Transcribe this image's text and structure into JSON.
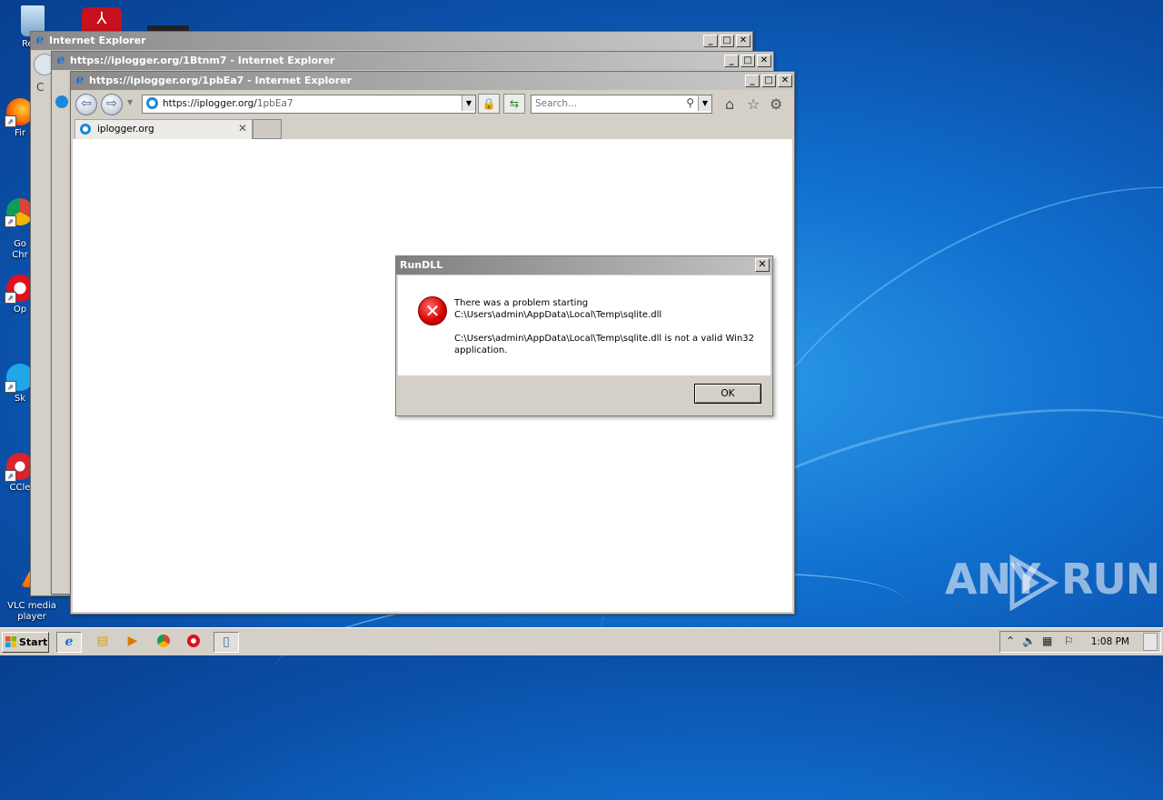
{
  "desktop": {
    "icons": [
      {
        "label": "Recy",
        "icon": "recycle-bin-icon"
      },
      {
        "label": "",
        "icon": "acrobat-reader-icon"
      },
      {
        "label": "Fir",
        "icon": "firefox-icon"
      },
      {
        "label": "Go\nChr",
        "icon": "chrome-icon"
      },
      {
        "label": "Op",
        "icon": "opera-icon"
      },
      {
        "label": "Sk",
        "icon": "skype-icon"
      },
      {
        "label": "CCle",
        "icon": "ccleaner-icon"
      },
      {
        "label": "VLC media\nplayer",
        "icon": "vlc-icon"
      }
    ]
  },
  "windows": [
    {
      "title": "Internet Explorer"
    },
    {
      "title": "https://iplogger.org/1Btnm7 - Internet Explorer"
    },
    {
      "title": "https://iplogger.org/1pbEa7 - Internet Explorer",
      "address": {
        "host": "https://iplogger.org/",
        "path": "1pbEa7"
      },
      "search_placeholder": "Search...",
      "tab_label": "iplogger.org",
      "partial_tab_text": "C"
    }
  ],
  "dialog": {
    "title": "RunDLL",
    "line1": "There was a problem starting",
    "line2": "C:\\Users\\admin\\AppData\\Local\\Temp\\sqlite.dll",
    "line3": "C:\\Users\\admin\\AppData\\Local\\Temp\\sqlite.dll is not a valid Win32",
    "line4": "application.",
    "ok_label": "OK"
  },
  "watermark": {
    "left": "ANY",
    "right": "RUN"
  },
  "taskbar": {
    "start_label": "Start",
    "items": [
      "ie-icon",
      "explorer-icon",
      "media-player-icon",
      "chrome-icon",
      "opera-icon",
      "notepad-icon"
    ],
    "clock": "1:08 PM"
  },
  "colors": {
    "desktop": "#1170cf",
    "title_gradient": "#8a8a8a",
    "error_red": "#d40000"
  }
}
